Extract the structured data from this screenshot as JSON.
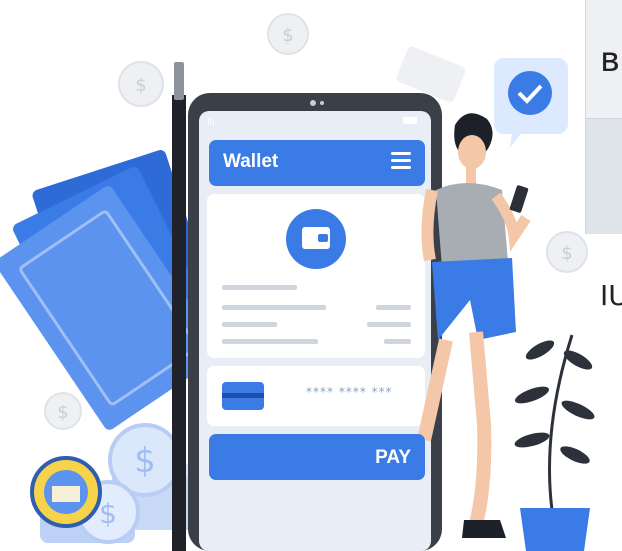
{
  "wallet": {
    "title": "Wallet",
    "card_number": "**** **** ***",
    "pay_label": "PAY"
  },
  "side_panel": {
    "row1_text": "ʙ",
    "row2_text": "IU"
  },
  "icons": [
    "dollar-coin-icon",
    "check-badge-icon",
    "wallet-icon",
    "credit-card-icon",
    "cart-icon",
    "menu-icon"
  ],
  "colors": {
    "accent": "#3a7be6",
    "accent_light": "#dce9ff",
    "check_badge": "#3a7be6"
  }
}
